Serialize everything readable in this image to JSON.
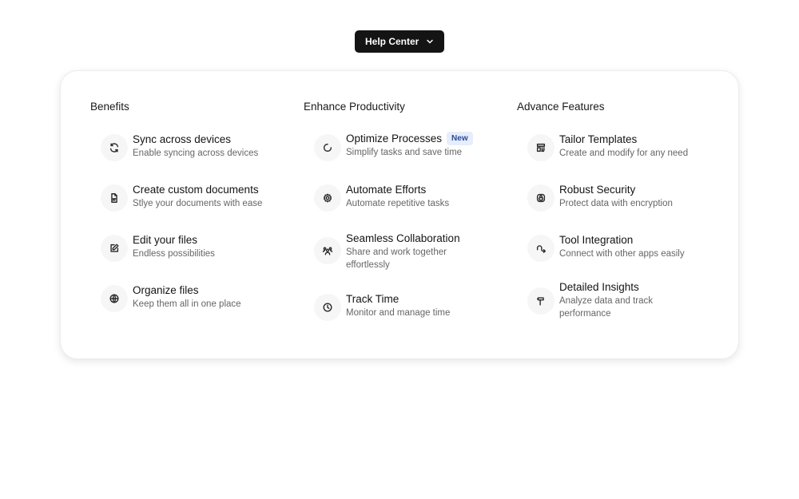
{
  "trigger": {
    "label": "Help Center"
  },
  "columns": [
    {
      "title": "Benefits",
      "items": [
        {
          "title": "Sync across devices",
          "desc": "Enable syncing across devices",
          "icon": "sync-icon"
        },
        {
          "title": "Create custom documents",
          "desc": "Stlye your documents with ease",
          "icon": "document-icon"
        },
        {
          "title": "Edit your files",
          "desc": "Endless possibilities",
          "icon": "edit-icon"
        },
        {
          "title": "Organize files",
          "desc": "Keep them all in one place",
          "icon": "organize-icon"
        }
      ]
    },
    {
      "title": "Enhance Productivity",
      "items": [
        {
          "title": "Optimize Processes",
          "badge": "New",
          "desc": "Simplify tasks and save time",
          "icon": "loader-icon"
        },
        {
          "title": "Automate Efforts",
          "desc": "Automate repetitive tasks",
          "icon": "settings-gear-icon"
        },
        {
          "title": "Seamless Collaboration",
          "desc": "Share and work together effortlessly",
          "icon": "users-icon"
        },
        {
          "title": "Track Time",
          "desc": "Monitor and manage time",
          "icon": "clock-icon"
        }
      ]
    },
    {
      "title": "Advance Features",
      "items": [
        {
          "title": "Tailor Templates",
          "desc": "Create and modify for any need",
          "icon": "template-icon"
        },
        {
          "title": "Robust Security",
          "desc": "Protect data with encryption",
          "icon": "lock-icon"
        },
        {
          "title": "Tool Integration",
          "desc": "Connect with other apps easily",
          "icon": "integration-icon"
        },
        {
          "title": "Detailed Insights",
          "desc": "Analyze data and track performance",
          "icon": "insights-icon"
        }
      ]
    }
  ],
  "colors": {
    "trigger_bg": "#141414",
    "badge_bg": "#e6edfb",
    "badge_text": "#2b4a9a"
  }
}
